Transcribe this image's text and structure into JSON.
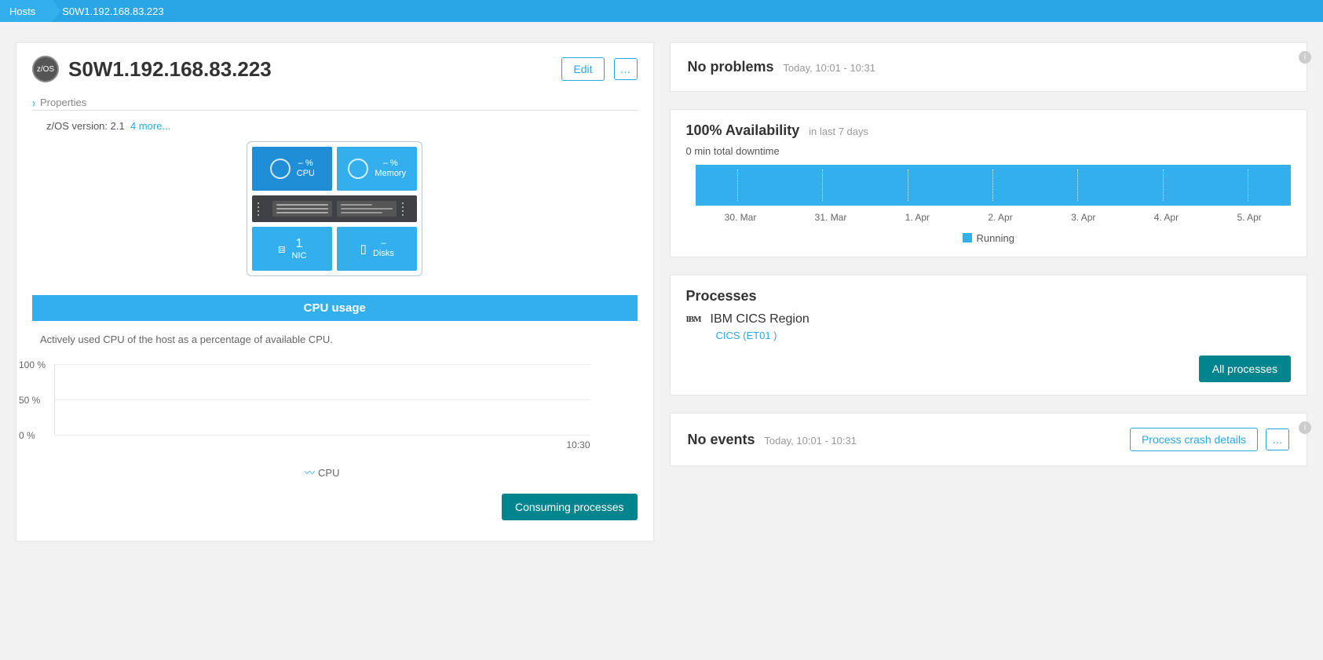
{
  "breadcrumb": {
    "root": "Hosts",
    "current": "S0W1.192.168.83.223"
  },
  "host": {
    "icon_label": "z/OS",
    "name": "S0W1.192.168.83.223",
    "edit": "Edit",
    "more": "…"
  },
  "properties": {
    "header": "Properties",
    "version_key": "z/OS version:",
    "version_val": "2.1",
    "more_link": "4 more..."
  },
  "tiles": {
    "cpu_value": "– %",
    "cpu_label": "CPU",
    "mem_value": "– %",
    "mem_label": "Memory",
    "nic_value": "1",
    "nic_label": "NIC",
    "disks_value": "–",
    "disks_label": "Disks"
  },
  "cpu_section": {
    "title": "CPU usage",
    "desc": "Actively used CPU of the host as a percentage of available CPU.",
    "legend": "CPU",
    "button": "Consuming processes"
  },
  "problems": {
    "title": "No problems",
    "period": "Today, 10:01 - 10:31"
  },
  "availability": {
    "title": "100% Availability",
    "period": "in last 7 days",
    "downtime": "0 min total downtime",
    "legend": "Running"
  },
  "processes": {
    "title": "Processes",
    "vendor": "IBM",
    "name": "IBM CICS Region",
    "link": "CICS (ET01 )",
    "button": "All processes"
  },
  "events": {
    "title": "No events",
    "period": "Today, 10:01 - 10:31",
    "button": "Process crash details",
    "more": "…"
  },
  "chart_data": {
    "availability": {
      "type": "bar",
      "categories": [
        "30. Mar",
        "31. Mar",
        "1. Apr",
        "2. Apr",
        "3. Apr",
        "4. Apr",
        "5. Apr"
      ],
      "values": [
        100,
        100,
        100,
        100,
        100,
        100,
        100
      ],
      "legend": "Running"
    },
    "cpu_usage": {
      "type": "line",
      "title": "CPU usage",
      "ylabel": "",
      "ylim": [
        0,
        100
      ],
      "y_ticks": [
        "100 %",
        "50 %",
        "0 %"
      ],
      "x_ticks": [
        "10:30"
      ],
      "series": [
        {
          "name": "CPU",
          "values": []
        }
      ]
    }
  }
}
